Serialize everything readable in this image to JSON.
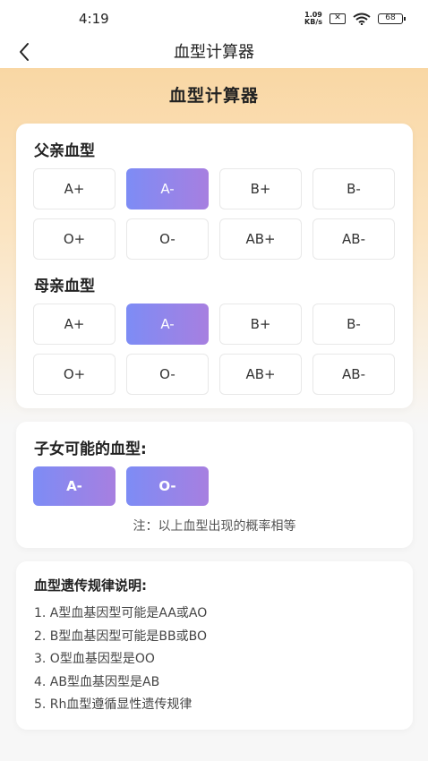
{
  "status_bar": {
    "time": "4:19",
    "net_speed_value": "1.09",
    "net_speed_unit": "KB/s",
    "battery": "68"
  },
  "nav": {
    "title": "血型计算器"
  },
  "page": {
    "heading": "血型计算器"
  },
  "father": {
    "label": "父亲血型",
    "options": [
      "A+",
      "A-",
      "B+",
      "B-",
      "O+",
      "O-",
      "AB+",
      "AB-"
    ],
    "selected": "A-"
  },
  "mother": {
    "label": "母亲血型",
    "options": [
      "A+",
      "A-",
      "B+",
      "B-",
      "O+",
      "O-",
      "AB+",
      "AB-"
    ],
    "selected": "A-"
  },
  "children": {
    "label": "子女可能的血型:",
    "results": [
      "A-",
      "O-"
    ],
    "note": "注：以上血型出现的概率相等"
  },
  "rules": {
    "title": "血型遗传规律说明:",
    "items": [
      "1. A型血基因型可能是AA或AO",
      "2. B型血基因型可能是BB或BO",
      "3. O型血基因型是OO",
      "4. AB型血基因型是AB",
      "5. Rh血型遵循显性遗传规律"
    ]
  },
  "colors": {
    "accent_start": "#7d8cf5",
    "accent_end": "#a77fe0",
    "header_gradient": "#f9d7a4"
  }
}
